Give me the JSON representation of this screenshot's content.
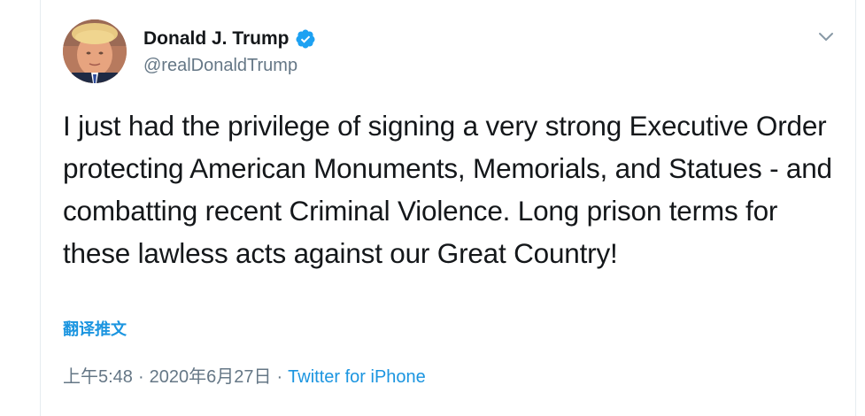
{
  "user": {
    "display_name": "Donald J. Trump",
    "handle": "@realDonaldTrump",
    "verified": true
  },
  "icons": {
    "verified": "verified-badge-icon",
    "menu": "chevron-down-icon",
    "avatar": "profile-photo"
  },
  "tweet": {
    "text": "I just had the privilege of signing a very strong Executive Order protecting American Monuments, Memorials, and Statues - and combatting recent Criminal Violence. Long prison terms for these lawless acts against our Great Country!",
    "translate_label": "翻译推文",
    "time": "上午5:48",
    "separator": "·",
    "date": "2020年6月27日",
    "source": "Twitter for iPhone"
  },
  "colors": {
    "text": "#14171a",
    "secondary": "#657786",
    "accent": "#1b95e0",
    "border": "#e6ecf0"
  }
}
